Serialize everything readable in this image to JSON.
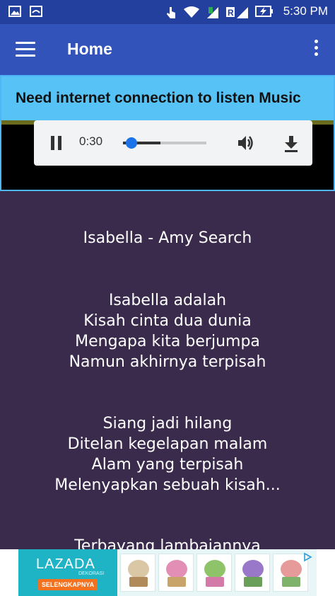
{
  "status_bar": {
    "time": "5:30 PM",
    "left_icons": [
      "image-icon",
      "app-icon"
    ],
    "right_icons": [
      "touch-icon",
      "wifi-icon",
      "signal-icon",
      "roaming-signal-icon",
      "battery-charging-icon"
    ]
  },
  "app_bar": {
    "title": "Home",
    "menu_icon": "hamburger-icon",
    "overflow_icon": "more-vert-icon"
  },
  "banner": {
    "text": "Need internet connection to listen Music"
  },
  "player": {
    "current_time": "0:30",
    "progress": 0.1,
    "buffered": 0.45
  },
  "lyrics": {
    "song_title": "Isabella - Amy Search",
    "verses": [
      [
        "Isabella adalah",
        "Kisah cinta dua dunia",
        "Mengapa kita berjumpa",
        "Namun akhirnya terpisah"
      ],
      [
        "Siang jadi hilang",
        "Ditelan kegelapan malam",
        "Alam yang terpisah",
        "Melenyapkan sebuah kisah..."
      ],
      [
        "Terbayang lambaiannya"
      ]
    ]
  },
  "ad": {
    "brand": "LAZADA",
    "brand_sub": "DEKORASI",
    "cta": "SELENGKAPNYA"
  },
  "colors": {
    "status_bar": "#23409f",
    "app_bar": "#3253b9",
    "banner": "#56c2f5",
    "lyrics_bg": "#3a2b4d",
    "accent": "#1a73e8"
  }
}
